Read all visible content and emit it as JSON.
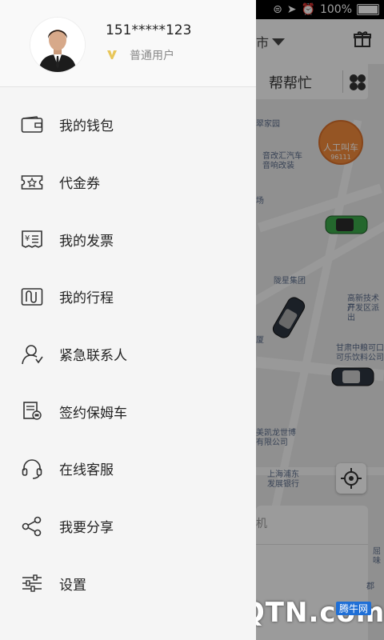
{
  "status_bar": {
    "battery_text": "100%"
  },
  "profile": {
    "phone": "151*****123",
    "user_level": "普通用户"
  },
  "menu": {
    "items": [
      {
        "label": "我的钱包",
        "icon": "wallet-icon"
      },
      {
        "label": "代金券",
        "icon": "voucher-icon"
      },
      {
        "label": "我的发票",
        "icon": "invoice-icon"
      },
      {
        "label": "我的行程",
        "icon": "trip-icon"
      },
      {
        "label": "紧急联系人",
        "icon": "emergency-contact-icon"
      },
      {
        "label": "签约保姆车",
        "icon": "contract-car-icon"
      },
      {
        "label": "在线客服",
        "icon": "headset-icon"
      },
      {
        "label": "我要分享",
        "icon": "share-icon"
      },
      {
        "label": "设置",
        "icon": "settings-icon"
      }
    ]
  },
  "background": {
    "city_label": "市",
    "tab_label": "帮帮忙",
    "call_badge": {
      "title": "人工叫车",
      "number": "96111"
    },
    "pois": [
      "翠家园",
      "音改汇汽车",
      "音响改装",
      "场",
      "陇星集团",
      "高新技术产",
      "开发区派出",
      "厦",
      "甘肃中粮可口",
      "可乐饮料公司",
      "美凯龙世博",
      "有限公司",
      "上海浦东",
      "发展银行",
      "屈味",
      "郡"
    ],
    "search_hint": "机"
  },
  "watermark": {
    "text": "QQTN.com",
    "sub": "腾牛网"
  },
  "colors": {
    "drawer_bg": "#f5f5f5",
    "badge": "#f08a3a",
    "car_green": "#3aa64a",
    "car_dark": "#2d3440"
  }
}
